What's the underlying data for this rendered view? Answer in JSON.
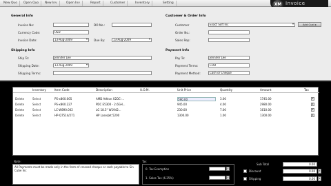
{
  "toolbar": {
    "buttons": [
      "New Quo",
      "Open Quo",
      "New Inv",
      "Open Inv",
      "Report",
      "Customer",
      "Inventory",
      "Setting"
    ],
    "brand_letters": "XM",
    "brand_text": "Invoice"
  },
  "general": {
    "title": "General Info",
    "invoice_no_label": "Invoice No:",
    "do_no_label": "DO No.:",
    "currency_label": "Currency Code:",
    "currency_value": "USD",
    "invoice_date_label": "Invoice Date:",
    "invoice_date_value": "13-Aug-2009",
    "due_label": "Due By:",
    "due_value": "13-Aug-2009"
  },
  "customer": {
    "title": "Customer & Order Info",
    "customer_label": "Customer",
    "customer_value": "Exact Soft Inc",
    "add_button": "Add Cust ▸",
    "order_label": "Order No.:",
    "sales_rep_label": "Sales Rep:"
  },
  "shipping": {
    "title": "Shipping Info",
    "ship_to_label": "Ship To:",
    "ship_to_value": "Jennifer Lee",
    "shipping_date_label": "Shipping Date:",
    "shipping_date_value": "13-Aug-2009",
    "terms_label": "Shipping Terms:"
  },
  "payment": {
    "title": "Payment Info",
    "pay_to_label": "Pay To:",
    "pay_to_value": "Jennifer Lee",
    "terms_label": "Payment Terms:",
    "terms_value": "COD",
    "method_label": "Payment Method:",
    "method_value": "Cash or Cheque"
  },
  "grid": {
    "headers": [
      "Inventory",
      "Item Code",
      "Description",
      "U.O.M.",
      "Unit Price",
      "Quantity",
      "Amount",
      "Tax"
    ],
    "rows": [
      {
        "del": "Delete",
        "sel": "Select",
        "code": "PS-x860.005",
        "desc": "AMD Athlon X2DC-...",
        "uom": "",
        "price": "590.00",
        "qty": "3.00",
        "amount": "1745.00"
      },
      {
        "del": "Delete",
        "sel": "Select",
        "code": "PS-x860.227",
        "desc": "PDC E5300 - 2.6GH...",
        "uom": "",
        "price": "945.00",
        "qty": "4.00",
        "amount": "2980.00"
      },
      {
        "del": "Delete",
        "sel": "Select",
        "code": "LC-W890.002",
        "desc": "LG 18.5\" W1942...",
        "uom": "",
        "price": "230.00",
        "qty": "7.00",
        "amount": "1610.00"
      },
      {
        "del": "Delete",
        "sel": "Select",
        "code": "HP-Q7514/271",
        "desc": "HP LaserJet 5200",
        "uom": "",
        "price": "1300.00",
        "qty": "1.00",
        "amount": "1300.00"
      }
    ]
  },
  "notes": {
    "label": "Note:",
    "text": "All Payments must be made only in the form of crossed cheque or cash payable to Sin Cube Inc"
  },
  "tax": {
    "label": "Tax",
    "option1": "0. Tax Exemption",
    "option2": "1. Sales Tax (6.25%)"
  },
  "totals": {
    "subtotal_label": "Sub Total",
    "subtotal_value": "0.00",
    "discount_label": "Discount",
    "discount_value": "0.00",
    "shipping_label": "Shipping",
    "shipping_value": "0.00"
  }
}
